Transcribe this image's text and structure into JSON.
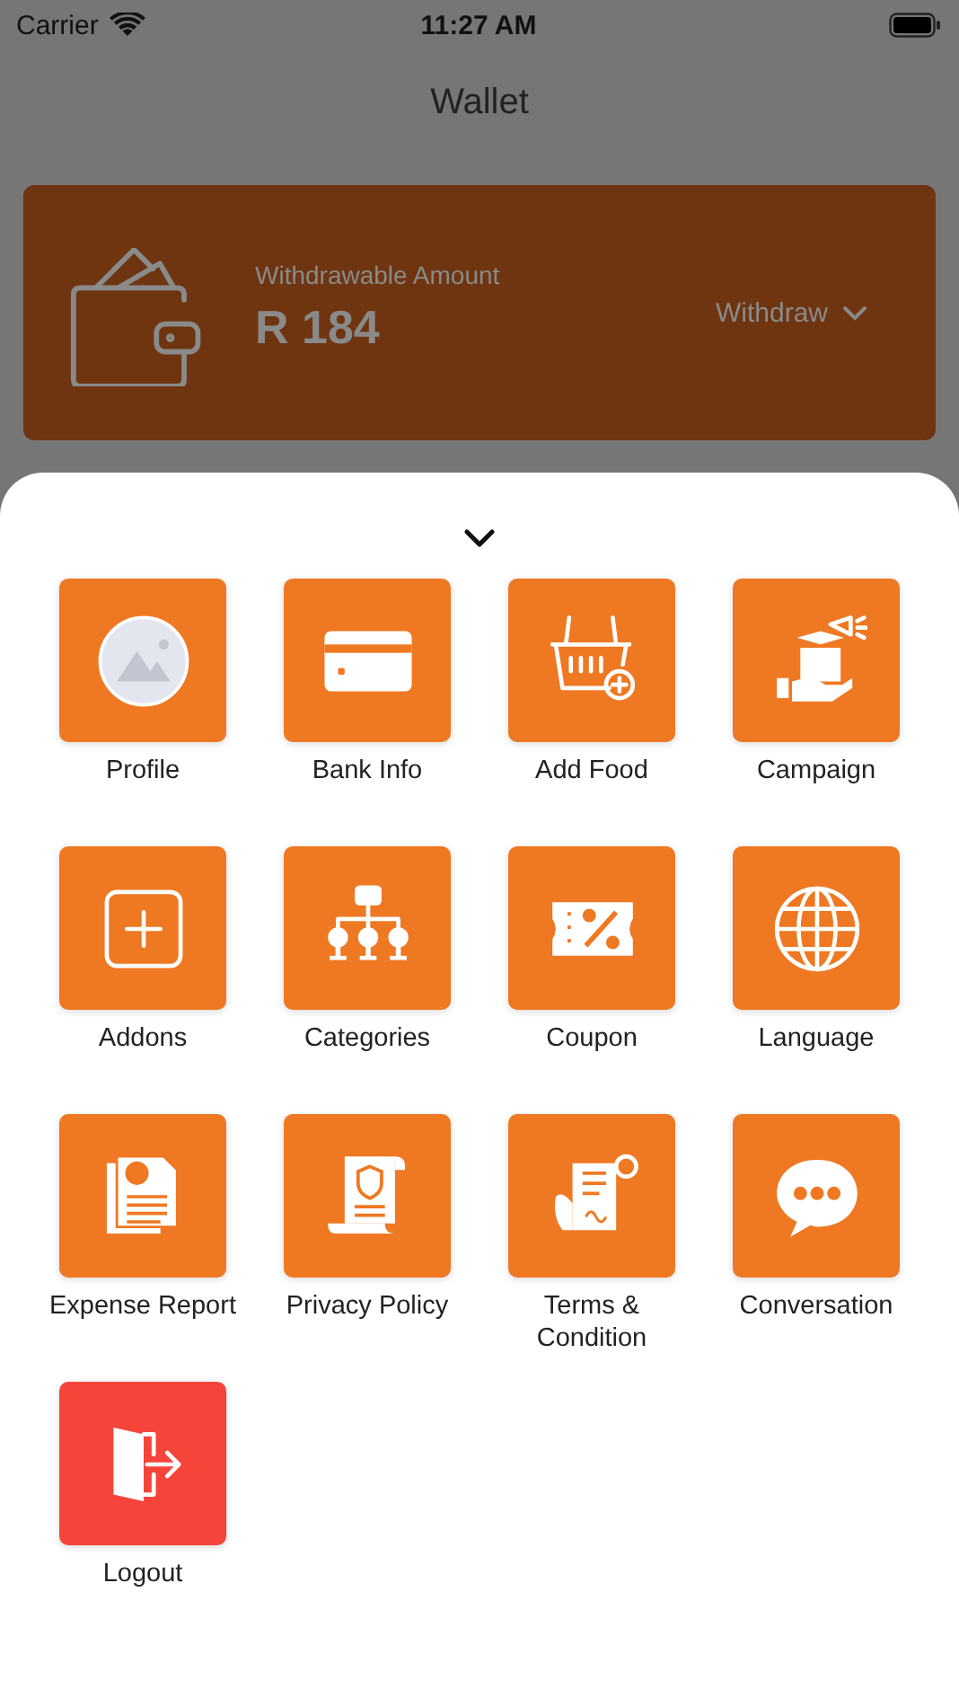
{
  "status_bar": {
    "carrier": "Carrier",
    "time": "11:27 AM"
  },
  "header": {
    "title": "Wallet"
  },
  "wallet_card": {
    "label": "Withdrawable Amount",
    "amount": "R 184",
    "action": "Withdraw"
  },
  "menu": {
    "items": [
      {
        "label": "Profile",
        "color": "#ef7822"
      },
      {
        "label": "Bank Info",
        "color": "#ef7822"
      },
      {
        "label": "Add Food",
        "color": "#ef7822"
      },
      {
        "label": "Campaign",
        "color": "#ef7822"
      },
      {
        "label": "Addons",
        "color": "#ef7822"
      },
      {
        "label": "Categories",
        "color": "#ef7822"
      },
      {
        "label": "Coupon",
        "color": "#ef7822"
      },
      {
        "label": "Language",
        "color": "#ef7822"
      },
      {
        "label": "Expense Report",
        "color": "#ef7822"
      },
      {
        "label": "Privacy Policy",
        "color": "#ef7822"
      },
      {
        "label": "Terms &\nCondition",
        "color": "#ef7822"
      },
      {
        "label": "Conversation",
        "color": "#ef7822"
      },
      {
        "label": "Logout",
        "color": "#f5453a"
      }
    ]
  }
}
